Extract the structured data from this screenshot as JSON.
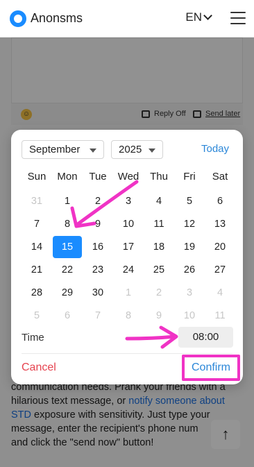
{
  "header": {
    "brand": "Anonsms",
    "language": "EN"
  },
  "compose": {
    "reply_off": "Reply Off",
    "send_later": "Send later"
  },
  "background_text": {
    "line1": "communication needs. Prank your friends with a",
    "line2a": "hilarious text message, or ",
    "line2_link": "notify someone about",
    "line3_link": "STD",
    "line3b": " exposure with sensitivity. Just type your",
    "line4": "message, enter the recipient's phone num",
    "line5": "and click the \"send now\" button!"
  },
  "scroll_top_glyph": "↑",
  "datepicker": {
    "month": "September",
    "year": "2025",
    "today_label": "Today",
    "weekdays": [
      "Sun",
      "Mon",
      "Tue",
      "Wed",
      "Thu",
      "Fri",
      "Sat"
    ],
    "weeks": [
      [
        {
          "d": "31",
          "m": true
        },
        {
          "d": "1"
        },
        {
          "d": "2"
        },
        {
          "d": "3"
        },
        {
          "d": "4"
        },
        {
          "d": "5"
        },
        {
          "d": "6"
        }
      ],
      [
        {
          "d": "7"
        },
        {
          "d": "8"
        },
        {
          "d": "9"
        },
        {
          "d": "10"
        },
        {
          "d": "11"
        },
        {
          "d": "12"
        },
        {
          "d": "13"
        }
      ],
      [
        {
          "d": "14"
        },
        {
          "d": "15",
          "sel": true
        },
        {
          "d": "16"
        },
        {
          "d": "17"
        },
        {
          "d": "18"
        },
        {
          "d": "19"
        },
        {
          "d": "20"
        }
      ],
      [
        {
          "d": "21"
        },
        {
          "d": "22"
        },
        {
          "d": "23"
        },
        {
          "d": "24"
        },
        {
          "d": "25"
        },
        {
          "d": "26"
        },
        {
          "d": "27"
        }
      ],
      [
        {
          "d": "28"
        },
        {
          "d": "29"
        },
        {
          "d": "30"
        },
        {
          "d": "1",
          "m": true
        },
        {
          "d": "2",
          "m": true
        },
        {
          "d": "3",
          "m": true
        },
        {
          "d": "4",
          "m": true
        }
      ],
      [
        {
          "d": "5",
          "m": true
        },
        {
          "d": "6",
          "m": true
        },
        {
          "d": "7",
          "m": true
        },
        {
          "d": "8",
          "m": true
        },
        {
          "d": "9",
          "m": true
        },
        {
          "d": "10",
          "m": true
        },
        {
          "d": "11",
          "m": true
        }
      ]
    ],
    "time_label": "Time",
    "time_value": "08:00",
    "cancel_label": "Cancel",
    "confirm_label": "Confirm"
  },
  "colors": {
    "accent": "#1a8cff",
    "link": "#2b87d8",
    "cancel": "#e6434f",
    "annotation": "#f033c5"
  }
}
